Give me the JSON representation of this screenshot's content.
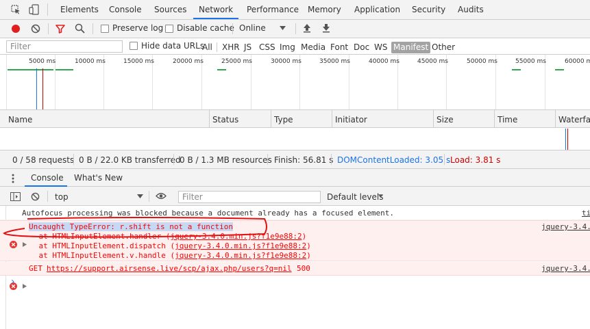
{
  "tabs": [
    {
      "label": "Elements"
    },
    {
      "label": "Console"
    },
    {
      "label": "Sources"
    },
    {
      "label": "Network"
    },
    {
      "label": "Performance"
    },
    {
      "label": "Memory"
    },
    {
      "label": "Application"
    },
    {
      "label": "Security"
    },
    {
      "label": "Audits"
    }
  ],
  "active_tab": "Network",
  "network_toolbar": {
    "preserve_log": "Preserve log",
    "disable_cache": "Disable cache",
    "throttling": "Online"
  },
  "filter_bar": {
    "placeholder": "Filter",
    "hide_data_urls": "Hide data URLs",
    "types": [
      "All",
      "XHR",
      "JS",
      "CSS",
      "Img",
      "Media",
      "Font",
      "Doc",
      "WS",
      "Manifest",
      "Other"
    ],
    "selected_type": "Manifest"
  },
  "timeline": {
    "ticks": [
      "5000 ms",
      "10000 ms",
      "15000 ms",
      "20000 ms",
      "25000 ms",
      "30000 ms",
      "35000 ms",
      "40000 ms",
      "45000 ms",
      "50000 ms",
      "55000 ms",
      "60000 ms"
    ]
  },
  "table": {
    "columns": [
      "Name",
      "Status",
      "Type",
      "Initiator",
      "Size",
      "Time",
      "Waterfall"
    ]
  },
  "summary": {
    "requests": "0 / 58 requests",
    "transferred": "0 B / 22.0 KB transferred",
    "resources": "0 B / 1.3 MB resources",
    "finish": "Finish: 56.81 s",
    "dom_content_loaded": "DOMContentLoaded: 3.05 s",
    "load": "Load: 3.81 s"
  },
  "drawer": {
    "tabs": [
      "Console",
      "What's New"
    ],
    "active_tab": "Console"
  },
  "console_toolbar": {
    "context": "top",
    "filter_placeholder": "Filter",
    "levels": "Default levels"
  },
  "console": {
    "message1": {
      "text": "Autofocus processing was blocked because a document already has a focused element.",
      "source": "ti"
    },
    "error1": {
      "title": "Uncaught TypeError: r.shift is not a function",
      "source": "jquery-3.4.",
      "stack": [
        {
          "prefix": "    at HTMLInputElement.handler (",
          "link": "jquery-3.4.0.min.js?f1e9e88:2",
          "suffix": ")"
        },
        {
          "prefix": "    at HTMLInputElement.dispatch (",
          "link": "jquery-3.4.0.min.js?f1e9e88:2",
          "suffix": ")"
        },
        {
          "prefix": "    at HTMLInputElement.v.handle (",
          "link": "jquery-3.4.0.min.js?f1e9e88:2",
          "suffix": ")"
        }
      ]
    },
    "error2": {
      "method": "GET",
      "url": "https://support.airsense.live/scp/ajax.php/users?q=nil",
      "status": "500",
      "source": "jquery-3.4."
    },
    "prompt": "›"
  },
  "colors": {
    "accent": "#1a73e8",
    "error_text": "#ff0000",
    "error_bg": "#fff0f0",
    "error_border": "#ffd6d6",
    "dcl": "#1a73e8",
    "load": "#c80000",
    "selection": "#c5d9f5",
    "annotation": "#e01010"
  }
}
